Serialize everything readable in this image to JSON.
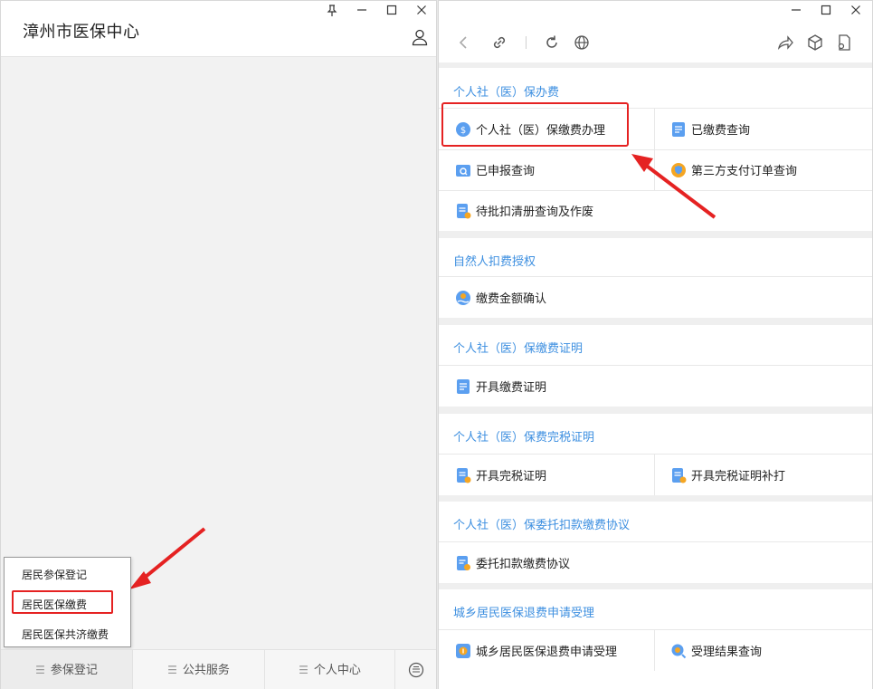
{
  "left_window": {
    "title": "漳州市医保中心",
    "popup_items": [
      "居民参保登记",
      "居民医保缴费",
      "居民医保共济缴费"
    ],
    "nav_items": [
      "参保登记",
      "公共服务",
      "个人中心"
    ]
  },
  "right_window": {
    "sections": [
      {
        "title": "个人社（医）保办费",
        "items": [
          "个人社（医）保缴费办理",
          "已缴费查询",
          "已申报查询",
          "第三方支付订单查询",
          "待批扣清册查询及作废"
        ]
      },
      {
        "title": "自然人扣费授权",
        "items": [
          "缴费金额确认"
        ]
      },
      {
        "title": "个人社（医）保缴费证明",
        "items": [
          "开具缴费证明"
        ]
      },
      {
        "title": "个人社（医）保费完税证明",
        "items": [
          "开具完税证明",
          "开具完税证明补打"
        ]
      },
      {
        "title": "个人社（医）保委托扣款缴费协议",
        "items": [
          "委托扣款缴费协议"
        ]
      },
      {
        "title": "城乡居民医保退费申请受理",
        "items": [
          "城乡居民医保退费申请受理",
          "受理结果查询"
        ]
      }
    ]
  },
  "colors": {
    "accent": "#3d8fe0",
    "highlight": "#e52222",
    "icon_blue": "#5b9ff0",
    "icon_orange": "#f5a623"
  }
}
